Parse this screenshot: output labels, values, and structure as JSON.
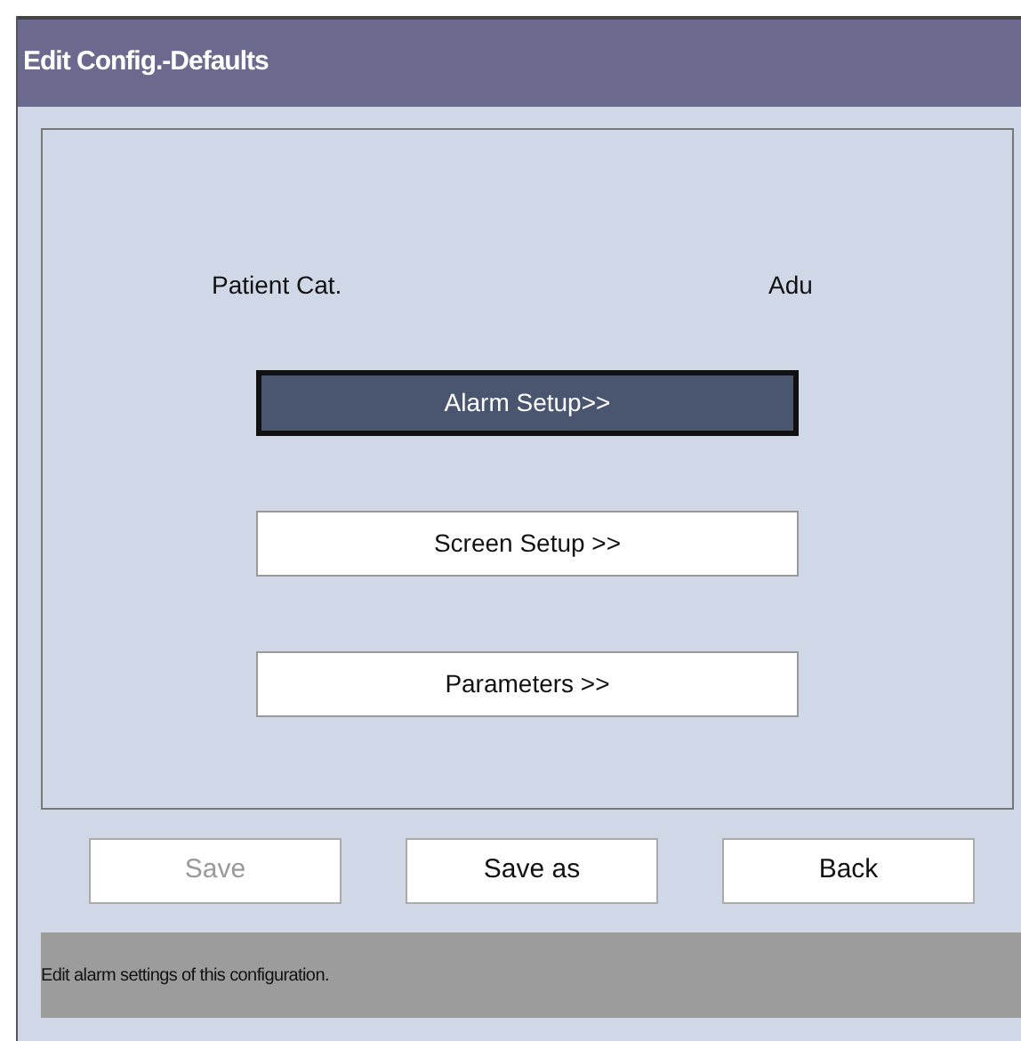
{
  "window": {
    "title": "Edit Config.-Defaults"
  },
  "patient_category": {
    "label": "Patient Cat.",
    "value": "Adu"
  },
  "menu_buttons": [
    {
      "label": "Alarm Setup>>",
      "selected": true
    },
    {
      "label": "Screen Setup >>",
      "selected": false
    },
    {
      "label": "Parameters >>",
      "selected": false
    }
  ],
  "buttons": [
    {
      "label": "Save",
      "disabled": true
    },
    {
      "label": "Save as",
      "disabled": false
    },
    {
      "label": "Back",
      "disabled": false
    }
  ],
  "status_bar": "Edit alarm settings of this configuration."
}
